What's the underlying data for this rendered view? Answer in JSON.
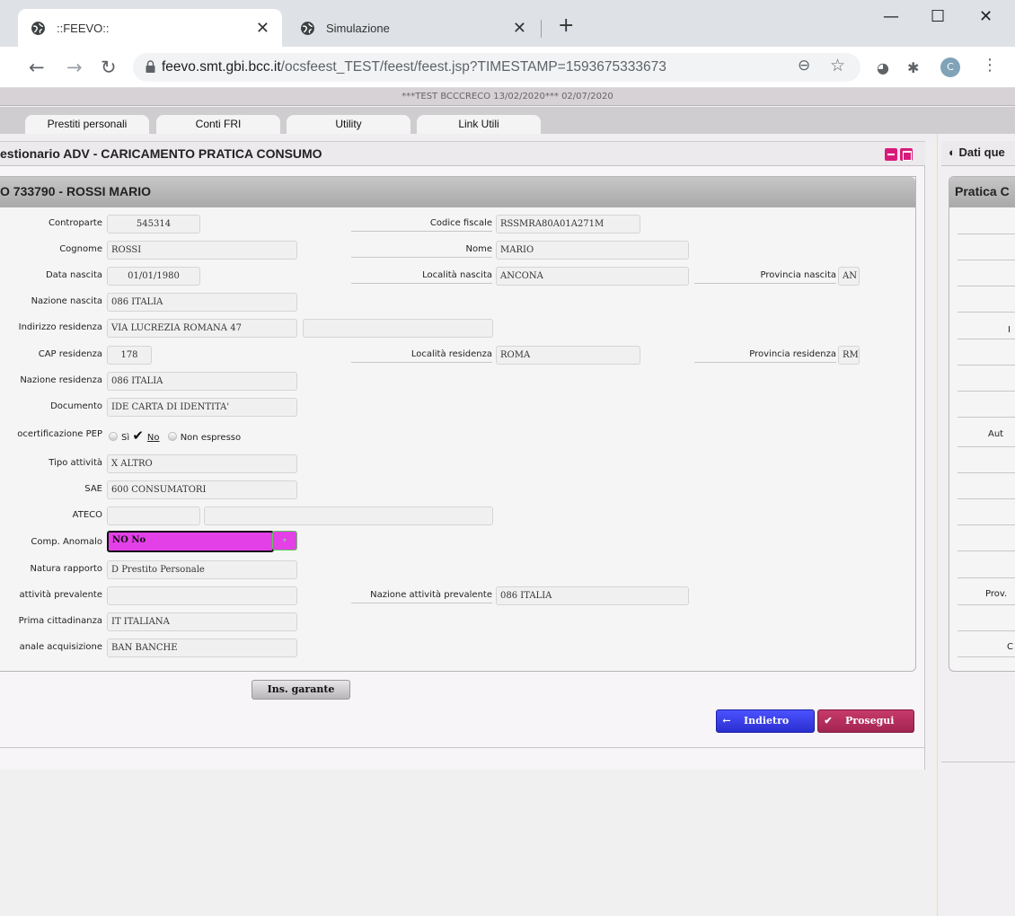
{
  "browser": {
    "tabs": [
      {
        "label": "::FEEVO::",
        "active": true
      },
      {
        "label": "Simulazione",
        "active": false
      }
    ],
    "url_host": "feevo.smt.gbi.bcc.it",
    "url_path": "/ocsfeest_TEST/feest/feest.jsp?TIMESTAMP=1593675333673",
    "avatar_letter": "C"
  },
  "app": {
    "banner": "***TEST BCCCRECO 13/02/2020*** 02/07/2020",
    "tabs": [
      "Prestiti personali",
      "Conti FRI",
      "Utility",
      "Link Utili"
    ],
    "panel_title": "estionario ADV - CARICAMENTO PRATICA CONSUMO",
    "form_title": "O 733790 - ROSSI MARIO",
    "right_panel_title": "Dati que",
    "right_box_title": "Pratica C",
    "right_labels": [
      "I",
      "Aut",
      "Prov.",
      "C"
    ]
  },
  "form": {
    "controparte_label": "Controparte",
    "controparte": "545314",
    "codice_fiscale_label": "Codice fiscale",
    "codice_fiscale": "RSSMRA80A01A271M",
    "cognome_label": "Cognome",
    "cognome": "ROSSI",
    "nome_label": "Nome",
    "nome": "MARIO",
    "data_nascita_label": "Data nascita",
    "data_nascita": "01/01/1980",
    "localita_nascita_label": "Località nascita",
    "localita_nascita": "ANCONA",
    "provincia_nascita_label": "Provincia nascita",
    "provincia_nascita": "AN",
    "nazione_nascita_label": "Nazione nascita",
    "nazione_nascita": "086 ITALIA",
    "indirizzo_residenza_label": "Indirizzo residenza",
    "indirizzo_residenza": "VIA LUCREZIA ROMANA 47",
    "indirizzo_residenza_2": "",
    "cap_residenza_label": "CAP residenza",
    "cap_residenza": "178",
    "localita_residenza_label": "Località residenza",
    "localita_residenza": "ROMA",
    "provincia_residenza_label": "Provincia residenza",
    "provincia_residenza": "RM",
    "nazione_residenza_label": "Nazione residenza",
    "nazione_residenza": "086 ITALIA",
    "documento_label": "Documento",
    "documento": "IDE CARTA DI IDENTITA'",
    "pep_label": "ocertificazione PEP",
    "pep_options": [
      "Sì",
      "No",
      "Non espresso"
    ],
    "pep_selected": "No",
    "tipo_attivita_label": "Tipo attività",
    "tipo_attivita": "X  ALTRO",
    "sae_label": "SAE",
    "sae": "600 CONSUMATORI",
    "ateco_label": "ATECO",
    "ateco": "",
    "ateco_desc": "",
    "comp_anomalo_label": "Comp. Anomalo",
    "comp_anomalo": "NO No",
    "natura_rapporto_label": "Natura rapporto",
    "natura_rapporto": "D  Prestito Personale",
    "attivita_prevalente_label": "attività prevalente",
    "attivita_prevalente": "",
    "nazione_attivita_prevalente_label": "Nazione attività prevalente",
    "nazione_attivita_prevalente": "086 ITALIA",
    "prima_cittadinanza_label": "Prima cittadinanza",
    "prima_cittadinanza": "IT  ITALIANA",
    "canale_acquisizione_label": "anale acquisizione",
    "canale_acquisizione": "BAN BANCHE"
  },
  "buttons": {
    "ins_garante": "Ins. garante",
    "indietro": "Indietro",
    "prosegui": "Prosegui"
  },
  "colors": {
    "highlight_field": "#e340e8",
    "back_button": "#2a2fd0",
    "next_button": "#a32451",
    "panel_buttons": "#d81b7a"
  }
}
